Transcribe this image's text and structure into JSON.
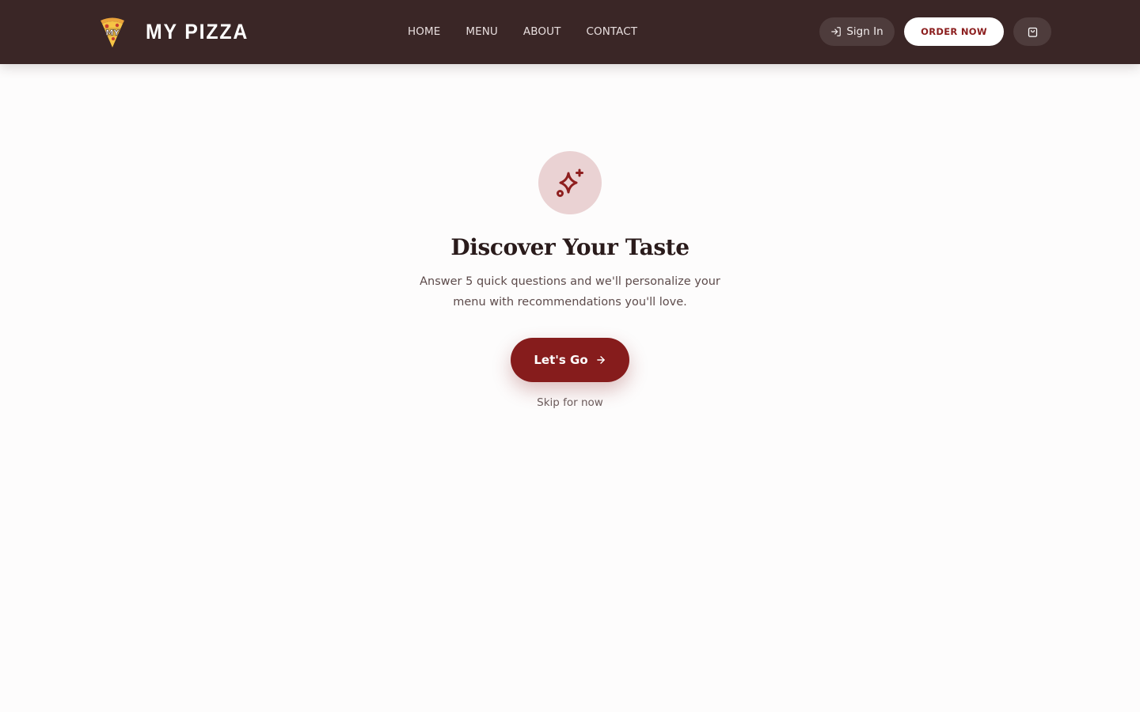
{
  "brand": {
    "logo_text": "MY",
    "name": "MY PIZZA"
  },
  "nav": {
    "items": [
      {
        "label": "HOME"
      },
      {
        "label": "MENU"
      },
      {
        "label": "ABOUT"
      },
      {
        "label": "CONTACT"
      }
    ]
  },
  "header_actions": {
    "sign_in_label": "Sign In",
    "sign_in_icon": "log-in-icon",
    "order_label": "ORDER NOW",
    "cart_icon": "shopping-bag-icon"
  },
  "intro": {
    "icon": "sparkles-icon",
    "title": "Discover Your Taste",
    "subtitle": "Answer 5 quick questions and we'll personalize your menu with recommendations you'll love.",
    "cta_label": "Let's Go",
    "cta_icon": "arrow-right-icon",
    "skip_label": "Skip for now"
  },
  "colors": {
    "header_bg": "#3a2626",
    "brand_red": "#861c1c",
    "icon_circle_bg": "#ead2d3",
    "page_bg": "#fdfcfc",
    "heading_text": "#2a1b1b",
    "body_text": "#5d4b4b"
  }
}
